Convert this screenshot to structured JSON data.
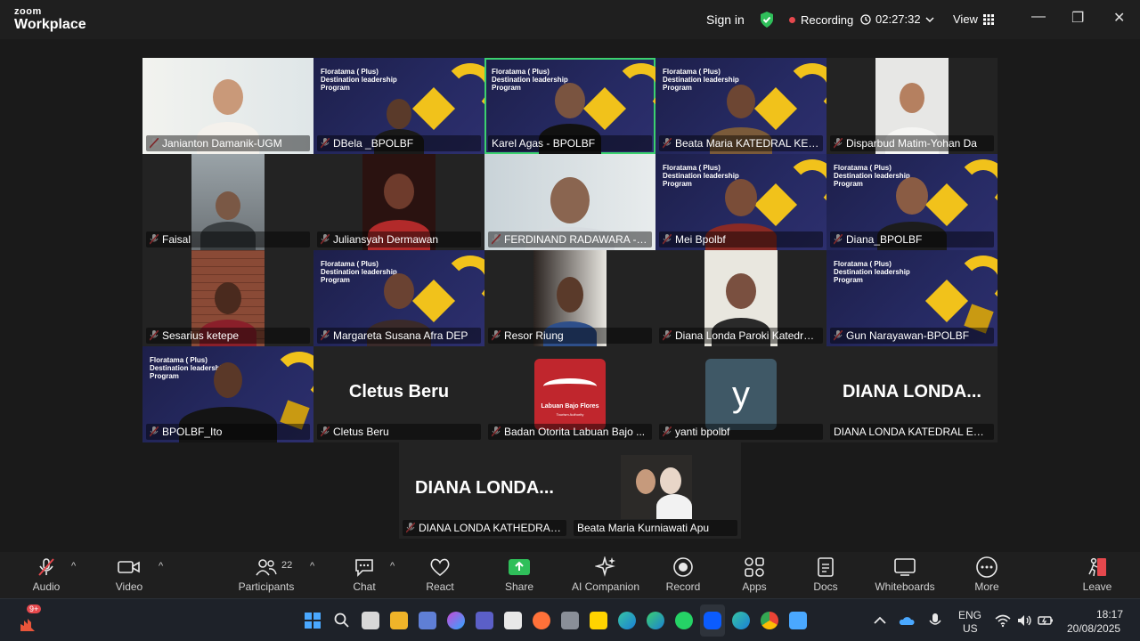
{
  "titlebar": {
    "brand_top": "zoom",
    "brand_bottom": "Workplace",
    "sign_in": "Sign in",
    "recording": "Recording",
    "timer": "02:27:32",
    "view": "View",
    "minimize": "—",
    "restore": "❐",
    "close": "✕"
  },
  "banner_text": "Floratama ( Plus) Destination leadership Program",
  "participants_tiles": [
    {
      "name": "Janianton Damanik-UGM"
    },
    {
      "name": "DBela _BPOLBF"
    },
    {
      "name": "Karel Agas - BPOLBF"
    },
    {
      "name": "Beata Maria KATEDRAL KEU..."
    },
    {
      "name": "Disparbud Matim-Yohan Da"
    },
    {
      "name": "Faisal"
    },
    {
      "name": "Juliansyah Dermawan"
    },
    {
      "name": "FERDINAND RADAWARA - D..."
    },
    {
      "name": "Mei Bpolbf"
    },
    {
      "name": "Diana_BPOLBF"
    },
    {
      "name": "Sesarius ketepe"
    },
    {
      "name": "Margareta Susana Afra DEP"
    },
    {
      "name": "Resor Riung"
    },
    {
      "name": "Diana Londa Paroki Katedral..."
    },
    {
      "name": "Gun Narayawan-BPOLBF"
    },
    {
      "name": "BPOLBF_Ito"
    },
    {
      "name": "Cletus Beru",
      "big": "Cletus Beru"
    },
    {
      "name": "Badan Otorita Labuan Bajo ...",
      "logo1": "Labuan Bajo Flores",
      "logo2": "Tourism Authority"
    },
    {
      "name": "yanti bpolbf",
      "initial": "y"
    },
    {
      "name": "DIANA LONDA KATEDRAL ENDE",
      "big": "DIANA  LONDA..."
    },
    {
      "name": "DIANA LONDA KATHEDRAL ...",
      "big": "DIANA  LONDA..."
    },
    {
      "name": "Beata Maria Kurniawati Apu"
    }
  ],
  "toolbar": {
    "audio": "Audio",
    "video": "Video",
    "participants": "Participants",
    "participants_count": "22",
    "chat": "Chat",
    "react": "React",
    "share": "Share",
    "ai": "AI Companion",
    "record": "Record",
    "apps": "Apps",
    "docs": "Docs",
    "whiteboards": "Whiteboards",
    "more": "More",
    "leave": "Leave"
  },
  "taskbar": {
    "notif_badge": "9+",
    "lang1": "ENG",
    "lang2": "US",
    "time": "18:17",
    "date": "20/08/2025"
  },
  "colors": {
    "accent_green": "#3bd16f",
    "share_green": "#2fbf5a",
    "record_red": "#e5484d",
    "banner_navy": "#262a63",
    "banner_yellow": "#f1c21b"
  }
}
